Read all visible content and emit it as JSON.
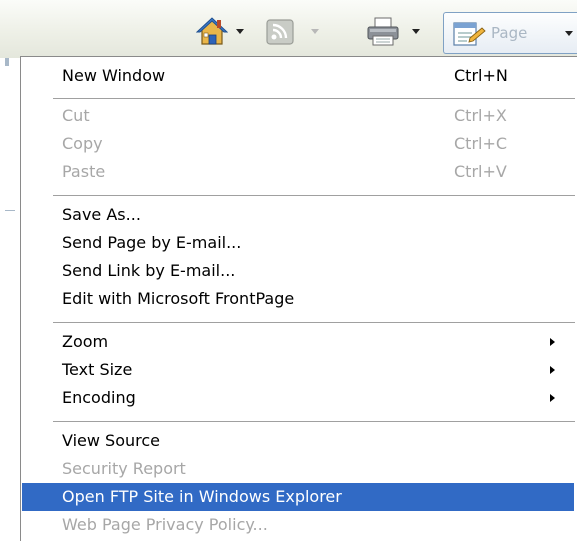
{
  "toolbar": {
    "buttons": [
      {
        "name": "home",
        "icon": "home-icon",
        "enabled": true
      },
      {
        "name": "feeds",
        "icon": "rss-feed-icon",
        "enabled": false
      },
      {
        "name": "print",
        "icon": "printer-icon",
        "enabled": true
      }
    ],
    "page_button": {
      "label": "Page",
      "icon": "page-icon"
    },
    "accent_color": "#316ac5"
  },
  "menu": {
    "items": [
      {
        "label": "New Window",
        "shortcut": "Ctrl+N",
        "enabled": true
      },
      {
        "label": "Cut",
        "shortcut": "Ctrl+X",
        "enabled": false
      },
      {
        "label": "Copy",
        "shortcut": "Ctrl+C",
        "enabled": false
      },
      {
        "label": "Paste",
        "shortcut": "Ctrl+V",
        "enabled": false
      },
      {
        "label": "Save As...",
        "shortcut": "",
        "enabled": true
      },
      {
        "label": "Send Page by E-mail...",
        "shortcut": "",
        "enabled": true
      },
      {
        "label": "Send Link by E-mail...",
        "shortcut": "",
        "enabled": true
      },
      {
        "label": "Edit with Microsoft FrontPage",
        "shortcut": "",
        "enabled": true
      },
      {
        "label": "Zoom",
        "shortcut": "",
        "enabled": true,
        "submenu": true
      },
      {
        "label": "Text Size",
        "shortcut": "",
        "enabled": true,
        "submenu": true
      },
      {
        "label": "Encoding",
        "shortcut": "",
        "enabled": true,
        "submenu": true
      },
      {
        "label": "View Source",
        "shortcut": "",
        "enabled": true
      },
      {
        "label": "Security Report",
        "shortcut": "",
        "enabled": false
      },
      {
        "label": "Open FTP Site in Windows Explorer",
        "shortcut": "",
        "enabled": true,
        "highlighted": true
      },
      {
        "label": "Web Page Privacy Policy...",
        "shortcut": "",
        "enabled": false
      }
    ]
  }
}
